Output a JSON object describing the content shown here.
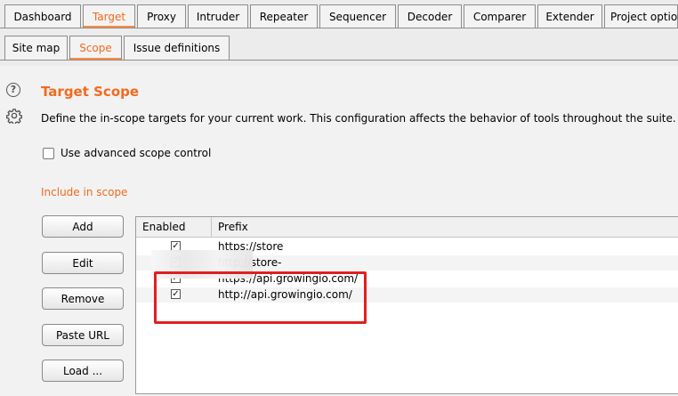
{
  "top_tabs": [
    "Dashboard",
    "Target",
    "Proxy",
    "Intruder",
    "Repeater",
    "Sequencer",
    "Decoder",
    "Comparer",
    "Extender",
    "Project optio"
  ],
  "sub_tabs": [
    "Site map",
    "Scope",
    "Issue definitions"
  ],
  "icons": {
    "help": "help-icon",
    "settings": "gear-icon",
    "check": "checkmark-icon"
  },
  "colors": {
    "accent": "#f26a1d",
    "highlight": "#e02020"
  },
  "main": {
    "title": "Target Scope",
    "help_symbol": "?",
    "description": "Define the in-scope targets for your current work. This configuration affects the behavior of tools throughout the suite.",
    "advanced_label": "Use advanced scope control",
    "advanced_checked": false,
    "include_label": "Include in scope"
  },
  "buttons": [
    "Add",
    "Edit",
    "Remove",
    "Paste URL",
    "Load ..."
  ],
  "table": {
    "headers": [
      "Enabled",
      "Prefix"
    ],
    "rows": [
      {
        "enabled": true,
        "prefix": "https://store"
      },
      {
        "enabled": true,
        "prefix": "http://store-"
      },
      {
        "enabled": true,
        "prefix": "https://api.growingio.com/"
      },
      {
        "enabled": true,
        "prefix": "http://api.growingio.com/"
      }
    ]
  }
}
